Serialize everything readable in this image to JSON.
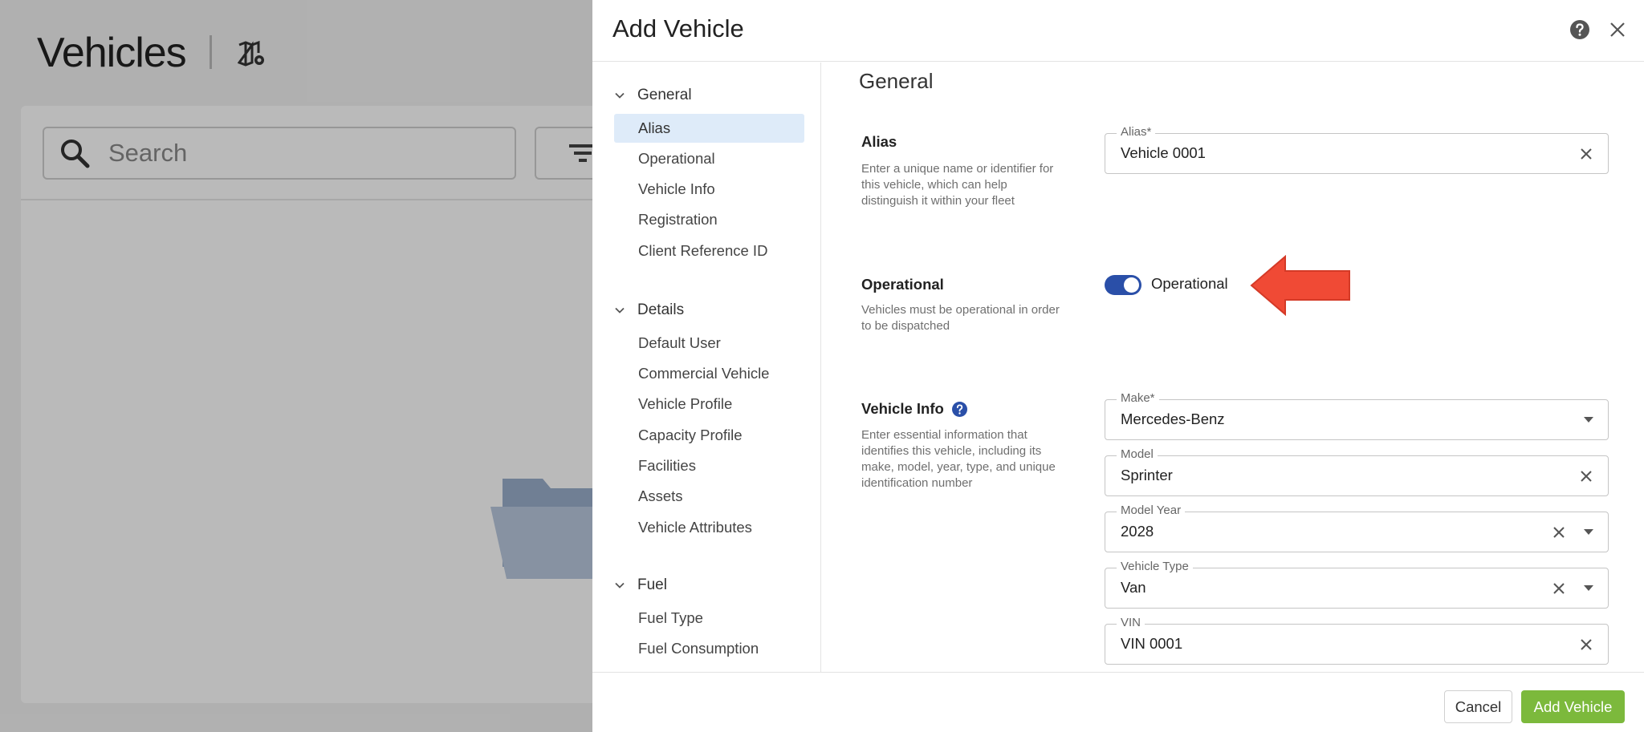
{
  "background": {
    "title": "Vehicles",
    "search_placeholder": "Search",
    "icons": {
      "map": "map-settings-icon",
      "search": "search-icon",
      "filter": "filter-icon",
      "folder": "folder-icon"
    }
  },
  "drawer": {
    "title": "Add Vehicle",
    "icons": {
      "help": "help-icon",
      "close": "close-icon"
    }
  },
  "nav": {
    "groups": [
      {
        "label": "General",
        "items": [
          "Alias",
          "Operational",
          "Vehicle Info",
          "Registration",
          "Client Reference ID"
        ]
      },
      {
        "label": "Details",
        "items": [
          "Default User",
          "Commercial Vehicle",
          "Vehicle Profile",
          "Capacity Profile",
          "Facilities",
          "Assets",
          "Vehicle Attributes"
        ]
      },
      {
        "label": "Fuel",
        "items": [
          "Fuel Type",
          "Fuel Consumption"
        ]
      }
    ],
    "active_item": "Alias"
  },
  "content": {
    "section_heading": "General",
    "alias": {
      "title": "Alias",
      "description": "Enter a unique name or identifier for this vehicle, which can help distinguish it within your fleet",
      "field_label": "Alias*",
      "field_value": "Vehicle 0001"
    },
    "operational": {
      "title": "Operational",
      "description": "Vehicles must be operational in order to be dispatched",
      "toggle_label": "Operational",
      "toggle_on": true,
      "annotation_color": "#f04a35"
    },
    "vehicle_info": {
      "title": "Vehicle Info",
      "description": "Enter essential information that identifies this vehicle, including its make, model, year, type, and unique identification number",
      "fields": {
        "make": {
          "label": "Make*",
          "value": "Mercedes-Benz"
        },
        "model": {
          "label": "Model",
          "value": "Sprinter"
        },
        "model_year": {
          "label": "Model Year",
          "value": "2028"
        },
        "vehicle_type": {
          "label": "Vehicle Type",
          "value": "Van"
        },
        "vin": {
          "label": "VIN",
          "value": "VIN 0001"
        }
      }
    }
  },
  "footer": {
    "cancel_label": "Cancel",
    "add_label": "Add Vehicle"
  },
  "colors": {
    "toggle": "#2a4fa8",
    "primary_button": "#7cb93c",
    "active_nav": "#deebf9",
    "annotation": "#f04a35"
  }
}
